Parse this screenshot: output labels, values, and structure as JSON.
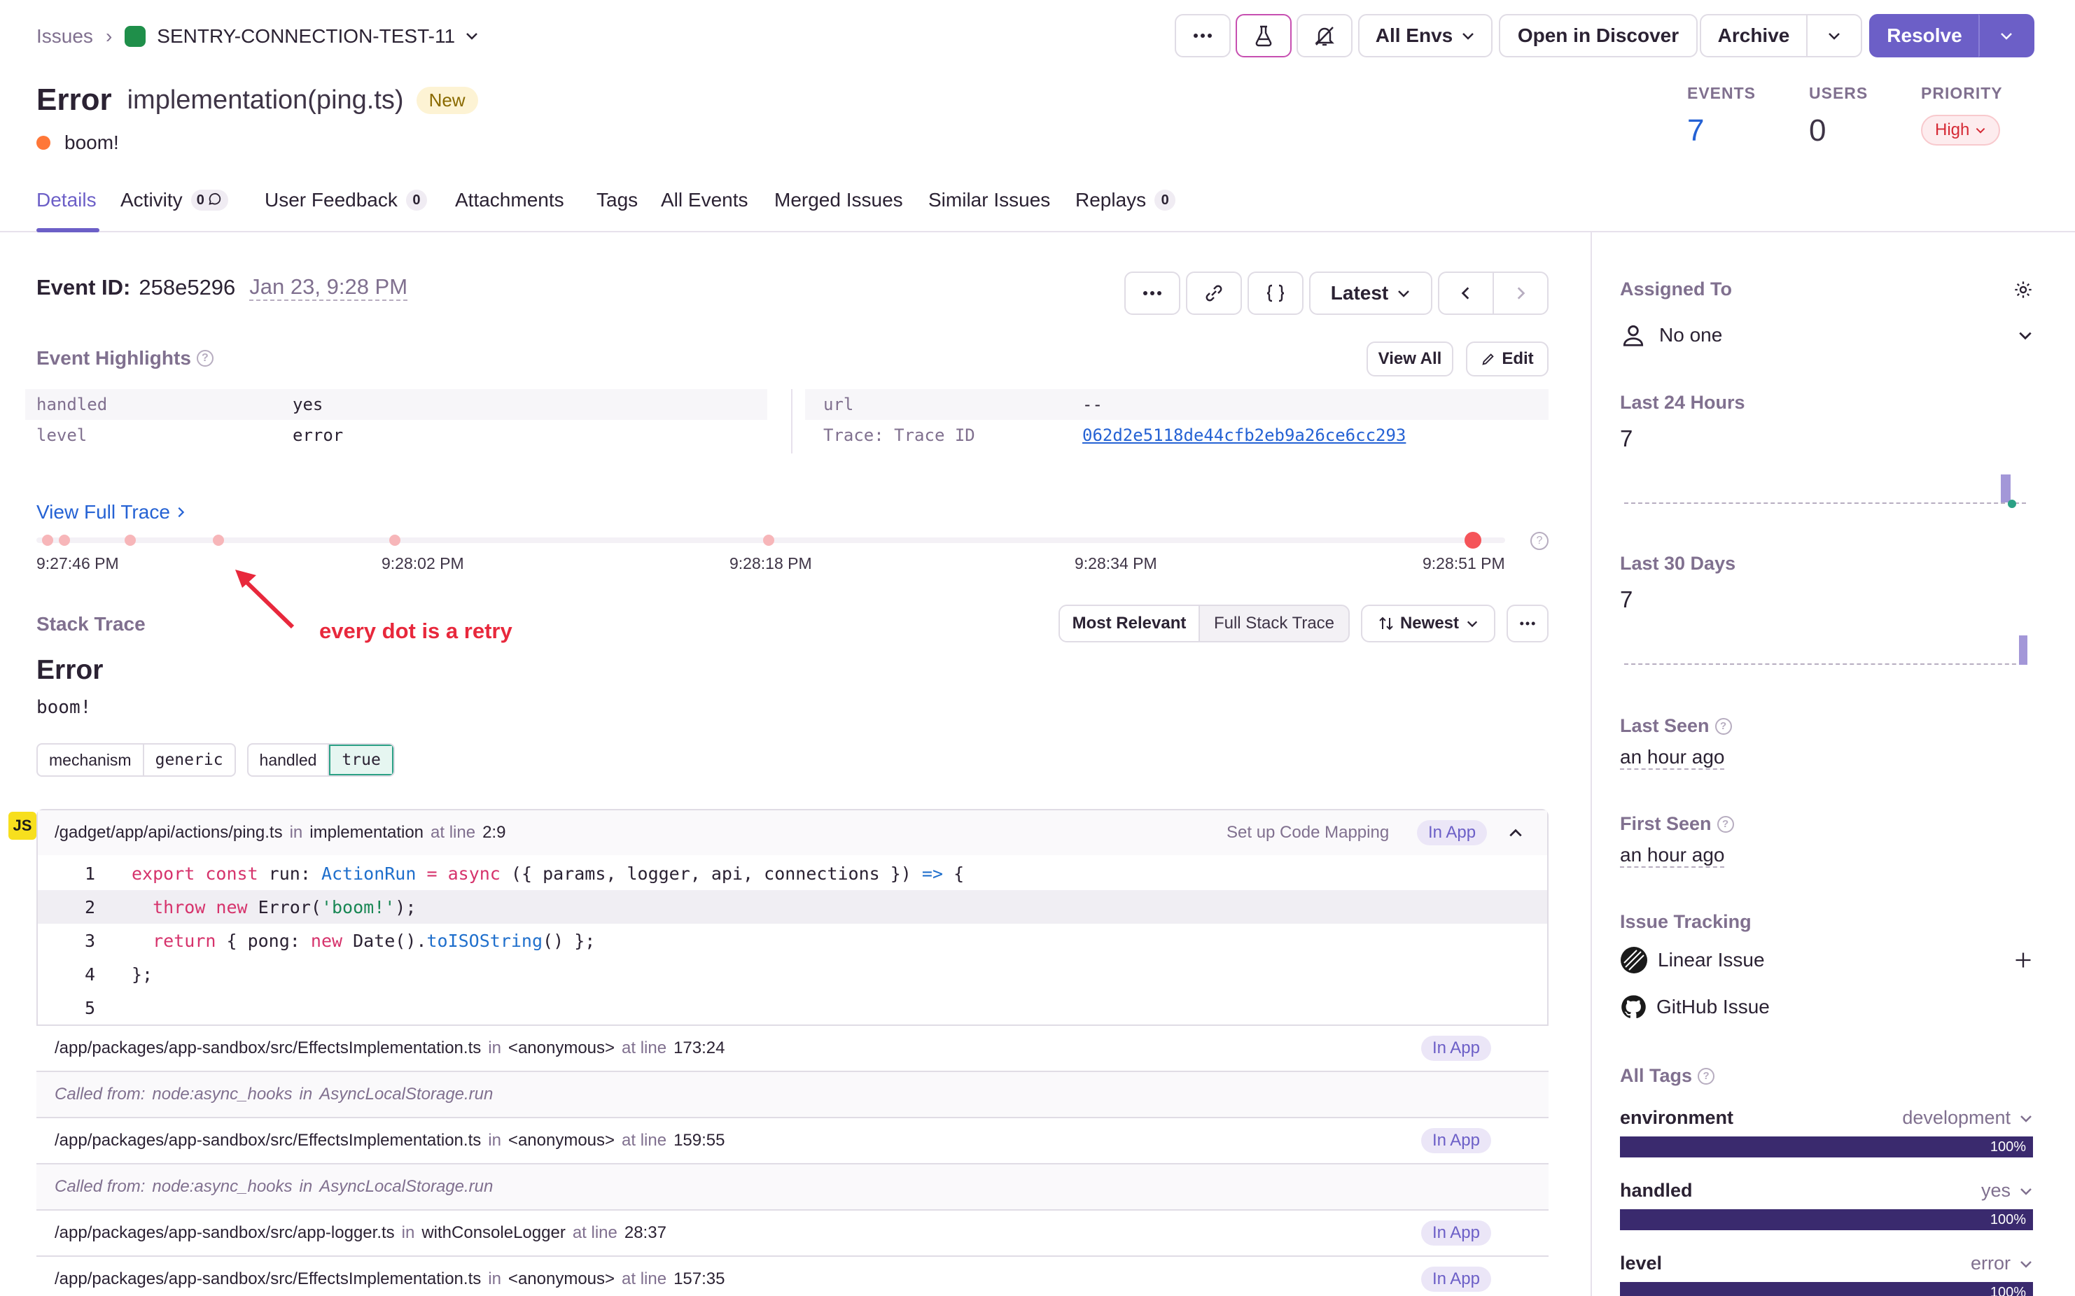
{
  "breadcrumb": {
    "root": "Issues",
    "project": "SENTRY-CONNECTION-TEST-11"
  },
  "header_actions": {
    "env": "All Envs",
    "discover": "Open in Discover",
    "archive": "Archive",
    "resolve": "Resolve"
  },
  "issue": {
    "type": "Error",
    "culprit": "implementation(ping.ts)",
    "badge": "New",
    "message": "boom!"
  },
  "stats": {
    "events_label": "EVENTS",
    "events": "7",
    "users_label": "USERS",
    "users": "0",
    "priority_label": "PRIORITY",
    "priority": "High"
  },
  "tabs": [
    {
      "label": "Details"
    },
    {
      "label": "Activity",
      "count": "0"
    },
    {
      "label": "User Feedback",
      "count": "0"
    },
    {
      "label": "Attachments"
    },
    {
      "label": "Tags"
    },
    {
      "label": "All Events"
    },
    {
      "label": "Merged Issues"
    },
    {
      "label": "Similar Issues"
    },
    {
      "label": "Replays",
      "count": "0"
    }
  ],
  "event": {
    "id_label": "Event ID:",
    "id": "258e5296",
    "date": "Jan 23, 9:28 PM",
    "latest": "Latest"
  },
  "highlights": {
    "title": "Event Highlights",
    "view_all": "View All",
    "edit": "Edit",
    "left": [
      {
        "k": "handled",
        "v": "yes"
      },
      {
        "k": "level",
        "v": "error"
      }
    ],
    "right": [
      {
        "k": "url",
        "v": "--"
      },
      {
        "k": "Trace: Trace ID",
        "v": "062d2e5118de44cfb2eb9a26ce6cc293"
      }
    ]
  },
  "trace": {
    "link": "View Full Trace",
    "ticks": [
      "9:27:46 PM",
      "9:28:02 PM",
      "9:28:18 PM",
      "9:28:34 PM",
      "9:28:51 PM"
    ],
    "annotation": "every dot is a retry"
  },
  "stack": {
    "title": "Stack Trace",
    "most_relevant": "Most Relevant",
    "full": "Full Stack Trace",
    "sort": "Newest",
    "exc_type": "Error",
    "exc_value": "boom!",
    "tags": [
      {
        "k": "mechanism",
        "v": "generic"
      },
      {
        "k": "handled",
        "v": "true"
      }
    ],
    "lang": "JS",
    "frame0": {
      "path": "/gadget/app/api/actions/ping.ts",
      "in": "in",
      "fn": "implementation",
      "at": "at line",
      "line": "2:9",
      "mapping": "Set up Code Mapping",
      "inapp": "In App"
    },
    "code": [
      "1",
      "2",
      "3",
      "4",
      "5"
    ],
    "frames": [
      {
        "path": "/app/packages/app-sandbox/src/EffectsImplementation.ts",
        "fn": "<anonymous>",
        "line": "173:24",
        "inapp": "In App"
      },
      {
        "called": "Called from:",
        "pkg": "node:async_hooks",
        "in": "in",
        "fn": "AsyncLocalStorage.run"
      },
      {
        "path": "/app/packages/app-sandbox/src/EffectsImplementation.ts",
        "fn": "<anonymous>",
        "line": "159:55",
        "inapp": "In App"
      },
      {
        "called": "Called from:",
        "pkg": "node:async_hooks",
        "in": "in",
        "fn": "AsyncLocalStorage.run"
      },
      {
        "path": "/app/packages/app-sandbox/src/app-logger.ts",
        "fn": "withConsoleLogger",
        "line": "28:37",
        "inapp": "In App"
      },
      {
        "path": "/app/packages/app-sandbox/src/EffectsImplementation.ts",
        "fn": "<anonymous>",
        "line": "157:35",
        "inapp": "In App"
      }
    ],
    "in_word": "in",
    "at_word": "at line"
  },
  "sidebar": {
    "assigned_label": "Assigned To",
    "assigned": "No one",
    "last24_label": "Last 24 Hours",
    "last24": "7",
    "last30_label": "Last 30 Days",
    "last30": "7",
    "last_seen_label": "Last Seen",
    "last_seen": "an hour ago",
    "first_seen_label": "First Seen",
    "first_seen": "an hour ago",
    "tracking_label": "Issue Tracking",
    "linear": "Linear Issue",
    "github": "GitHub Issue",
    "tags_label": "All Tags",
    "tags": [
      {
        "name": "environment",
        "value": "development",
        "pct": "100%"
      },
      {
        "name": "handled",
        "value": "yes",
        "pct": "100%"
      },
      {
        "name": "level",
        "value": "error",
        "pct": "100%"
      }
    ]
  },
  "colors": {
    "accent": "#6c5fc7",
    "error": "#f55459",
    "link": "#2562d4"
  }
}
